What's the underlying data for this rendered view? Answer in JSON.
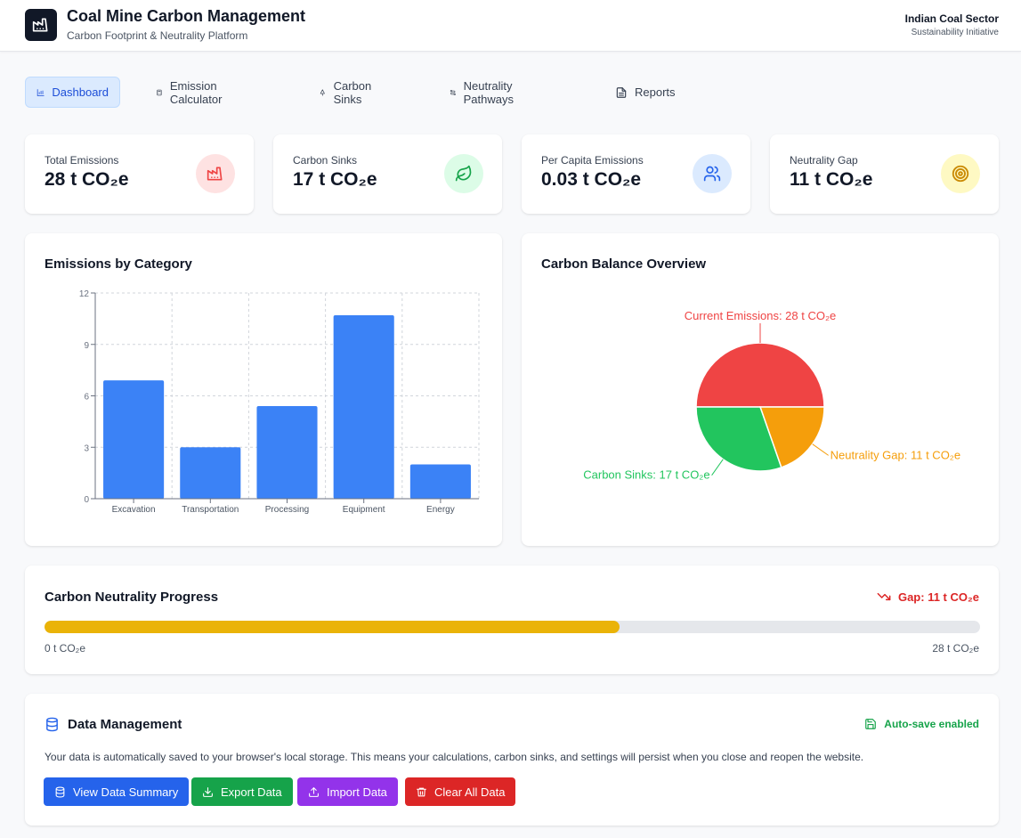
{
  "header": {
    "title": "Coal Mine Carbon Management",
    "subtitle": "Carbon Footprint & Neutrality Platform",
    "org_name": "Indian Coal Sector",
    "org_sub": "Sustainability Initiative"
  },
  "nav": {
    "items": [
      {
        "label": "Dashboard",
        "icon": "bar-chart-icon",
        "active": true
      },
      {
        "label": "Emission Calculator",
        "icon": "calculator-icon",
        "active": false
      },
      {
        "label": "Carbon Sinks",
        "icon": "tree-icon",
        "active": false
      },
      {
        "label": "Neutrality Pathways",
        "icon": "route-icon",
        "active": false
      },
      {
        "label": "Reports",
        "icon": "file-icon",
        "active": false
      }
    ]
  },
  "stats": [
    {
      "label": "Total Emissions",
      "value": "28 t CO₂e",
      "icon": "factory-icon",
      "color": "#ef4444",
      "bg": "#fee2e2"
    },
    {
      "label": "Carbon Sinks",
      "value": "17 t CO₂e",
      "icon": "leaf-icon",
      "color": "#16a34a",
      "bg": "#dcfce7"
    },
    {
      "label": "Per Capita Emissions",
      "value": "0.03 t CO₂e",
      "icon": "users-icon",
      "color": "#2563eb",
      "bg": "#dbeafe"
    },
    {
      "label": "Neutrality Gap",
      "value": "11 t CO₂e",
      "icon": "target-icon",
      "color": "#ca8a04",
      "bg": "#fef9c3"
    }
  ],
  "bar_card": {
    "title": "Emissions by Category"
  },
  "pie_card": {
    "title": "Carbon Balance Overview"
  },
  "chart_data": [
    {
      "type": "bar",
      "categories": [
        "Excavation",
        "Transportation",
        "Processing",
        "Equipment",
        "Energy"
      ],
      "values": [
        6.9,
        3.0,
        5.4,
        10.7,
        2.0
      ],
      "ylim": [
        0,
        12
      ],
      "yticks": [
        "0",
        "3",
        "6",
        "9",
        "12"
      ],
      "grid": true,
      "color": "#3b82f6"
    },
    {
      "type": "pie",
      "slices": [
        {
          "label": "Current Emissions: 28 t CO₂e",
          "value": 28,
          "color": "#ef4444"
        },
        {
          "label": "Neutrality Gap: 11 t CO₂e",
          "value": 11,
          "color": "#f59e0b"
        },
        {
          "label": "Carbon Sinks: 17 t CO₂e",
          "value": 17,
          "color": "#22c55e"
        }
      ]
    }
  ],
  "progress": {
    "title": "Carbon Neutrality Progress",
    "gap_label": "Gap: 11 t CO₂e",
    "fraction": 0.615,
    "min_label": "0 t CO₂e",
    "max_label": "28 t CO₂e",
    "fill_color": "#eab308"
  },
  "data_management": {
    "title": "Data Management",
    "autosave": "Auto-save enabled",
    "description": "Your data is automatically saved to your browser's local storage. This means your calculations, carbon sinks, and settings will persist when you close and reopen the website.",
    "buttons": [
      {
        "label": "View Data Summary",
        "icon": "database-icon",
        "color": "#2563eb"
      },
      {
        "label": "Export Data",
        "icon": "download-icon",
        "color": "#16a34a"
      },
      {
        "label": "Import Data",
        "icon": "upload-icon",
        "color": "#9333ea"
      },
      {
        "label": "Clear All Data",
        "icon": "trash-icon",
        "color": "#dc2626"
      }
    ]
  }
}
